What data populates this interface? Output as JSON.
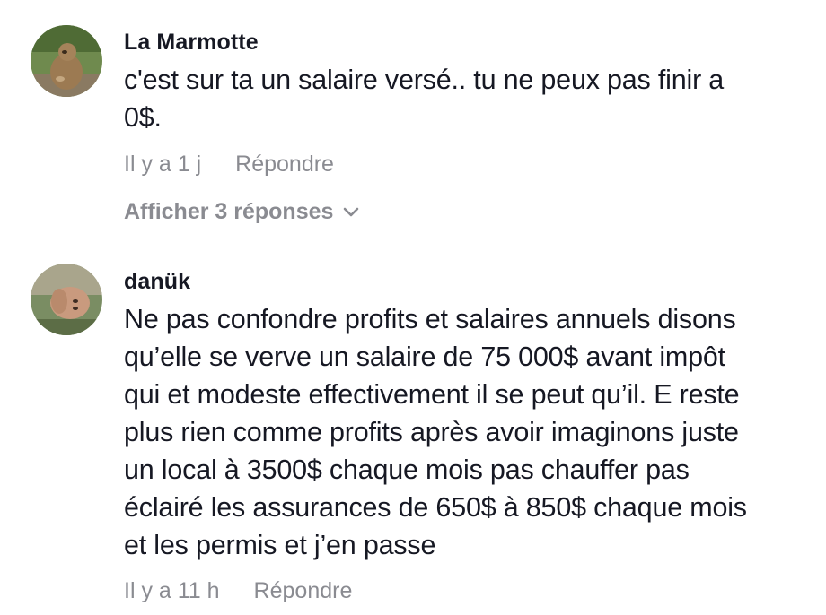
{
  "comments": [
    {
      "username": "La Marmotte",
      "text_lines": [
        "c'est sur ta un salaire versé.. tu ne peux pas finir a",
        "0$."
      ],
      "time": "Il y a 1 j",
      "reply_label": "Répondre",
      "view_replies_label": "Afficher 3 réponses"
    },
    {
      "username": "danük",
      "text_lines": [
        "Ne pas confondre profits et salaires annuels disons",
        "qu’elle se verve un salaire de 75 000$ avant impôt",
        "qui et modeste effectivement il se peut qu’il. E reste",
        "plus rien comme profits après avoir imaginons juste",
        "un local à 3500$ chaque mois pas chauffer pas",
        "éclairé les assurances de 650$ à 850$ chaque mois",
        "et les permis et j’en passe"
      ],
      "time": "Il y a 11 h",
      "reply_label": "Répondre"
    }
  ]
}
